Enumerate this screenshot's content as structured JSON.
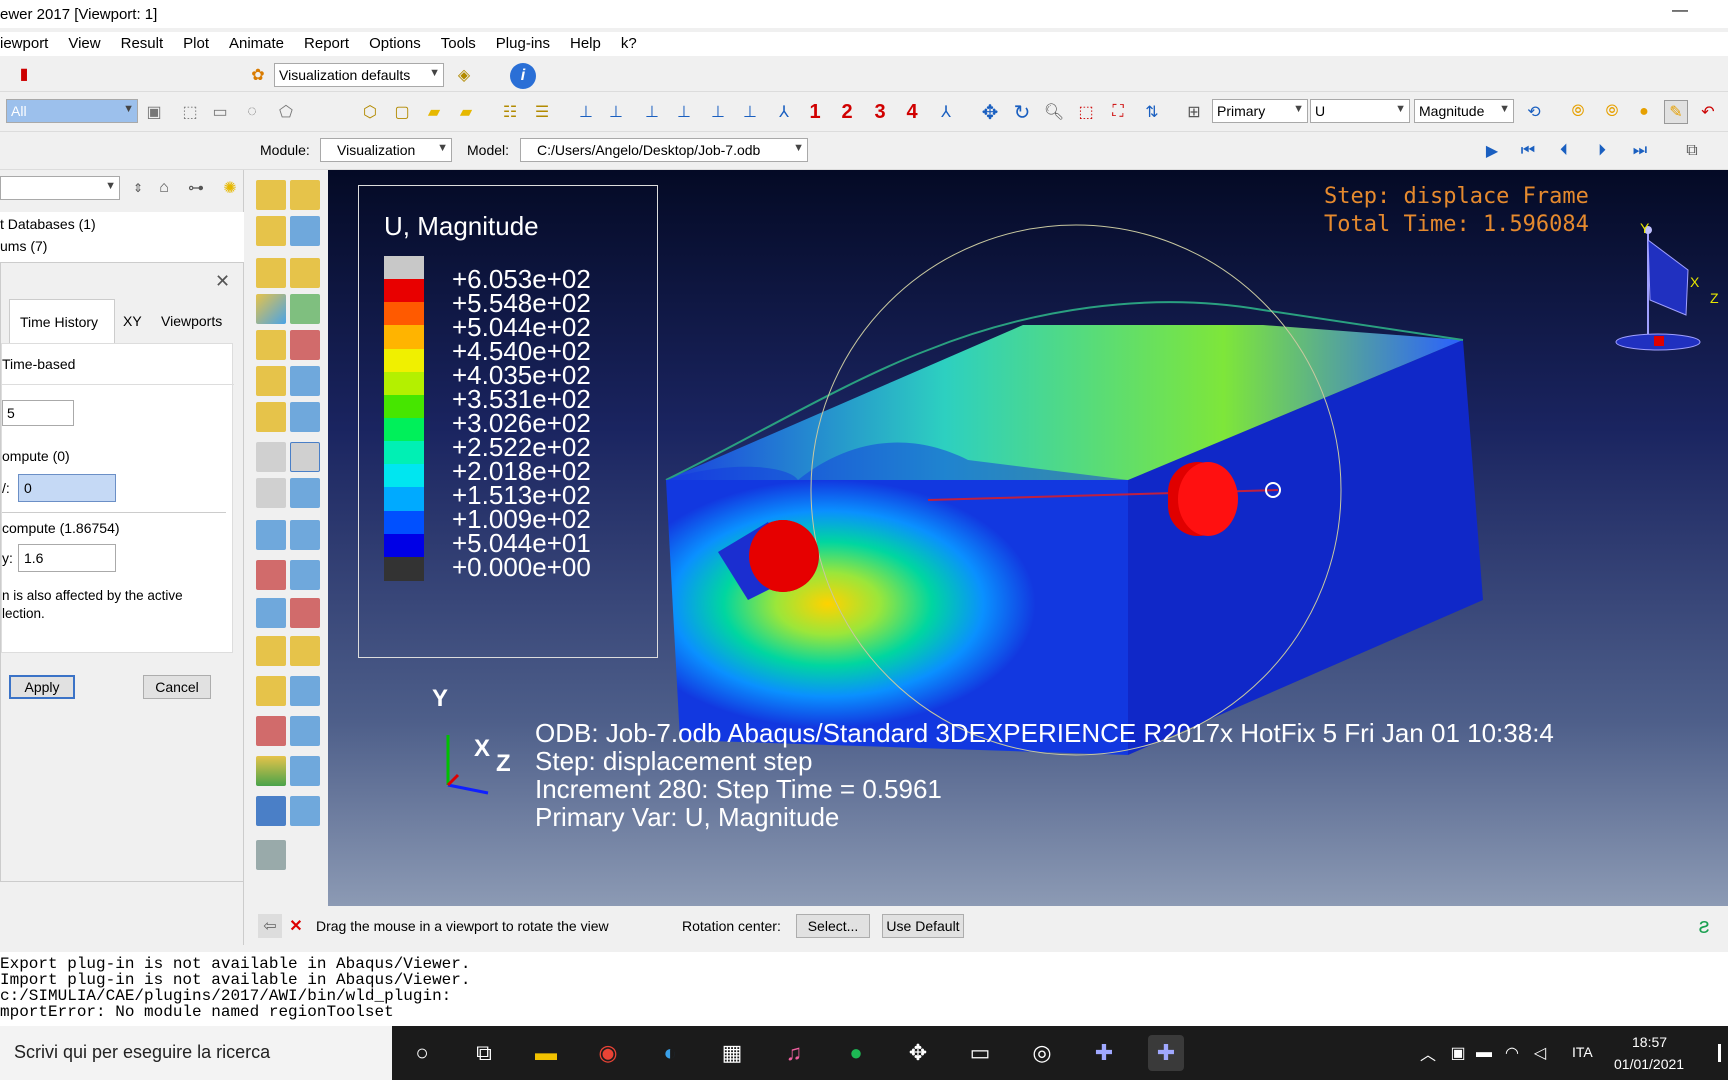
{
  "window": {
    "title": "ewer 2017 [Viewport: 1]",
    "minimize_glyph": "—"
  },
  "menu": [
    "iewport",
    "View",
    "Result",
    "Plot",
    "Animate",
    "Report",
    "Options",
    "Tools",
    "Plug-ins",
    "Help",
    "k?"
  ],
  "toolbar1": {
    "visualization_defaults": "Visualization defaults",
    "info_icon": "i"
  },
  "toolbar2": {
    "selection_filter": "All",
    "view_numbers": [
      "1",
      "2",
      "3",
      "4"
    ],
    "primary_select": "Primary",
    "variable_select": "U",
    "invariant_select": "Magnitude"
  },
  "context_bar": {
    "module_label": "Module:",
    "module_value": "Visualization",
    "model_label": "Model:",
    "model_value": "C:/Users/Angelo/Desktop/Job-7.odb"
  },
  "tree": {
    "items": [
      "t Databases (1)",
      "ums (7)"
    ]
  },
  "dialog": {
    "tabs": [
      "Time History",
      "XY",
      "Viewports"
    ],
    "mode": "Time-based",
    "first_value": "5",
    "min_compute": "ompute  (0)",
    "min_prefix": "/:",
    "min_value": "0",
    "max_compute": "compute  (1.86754)",
    "max_prefix": "y:",
    "max_value": "1.6",
    "note_line1": "n is also affected by the active",
    "note_line2": "lection.",
    "apply": "Apply",
    "cancel": "Cancel"
  },
  "legend": {
    "title": "U, Magnitude",
    "levels": [
      "+6.053e+02",
      "+5.548e+02",
      "+5.044e+02",
      "+4.540e+02",
      "+4.035e+02",
      "+3.531e+02",
      "+3.026e+02",
      "+2.522e+02",
      "+2.018e+02",
      "+1.513e+02",
      "+1.009e+02",
      "+5.044e+01",
      "+0.000e+00"
    ],
    "colors": [
      "#c8c8c8",
      "#e80000",
      "#ff5a00",
      "#ffb400",
      "#f0f000",
      "#b4f000",
      "#46e600",
      "#00f05a",
      "#00f0b4",
      "#00e6f0",
      "#00aaff",
      "#0050ff",
      "#0000e6",
      "#333333"
    ]
  },
  "viewport_info": {
    "step_line": "Step: displace Frame",
    "time_line": "Total Time: 1.596084",
    "odb_line": "ODB: Job-7.odb      Abaqus/Standard 3DEXPERIENCE R2017x HotFix 5      Fri Jan 01 10:38:4",
    "step_desc": "Step: displacement step",
    "increment": "Increment      280: Step Time =     0.5961",
    "primary_var": "Primary Var: U, Magnitude",
    "triad": {
      "y": "Y",
      "x": "X",
      "z": "Z"
    },
    "view_triad": {
      "y": "Y",
      "x": "X",
      "z": "Z"
    }
  },
  "prompt": {
    "message": "Drag the mouse in a viewport to rotate the view",
    "rotation_label": "Rotation center:",
    "select_button": "Select...",
    "default_button": "Use Default"
  },
  "console": [
    "Export plug-in is not available in Abaqus/Viewer.",
    "Import plug-in is not available in Abaqus/Viewer.",
    " c:/SIMULIA/CAE/plugins/2017/AWI/bin/wld_plugin:",
    "mportError: No module named regionToolset"
  ],
  "taskbar": {
    "search_placeholder": "Scrivi qui per eseguire la ricerca",
    "lang": "ITA",
    "time": "18:57",
    "date": "01/01/2021"
  }
}
